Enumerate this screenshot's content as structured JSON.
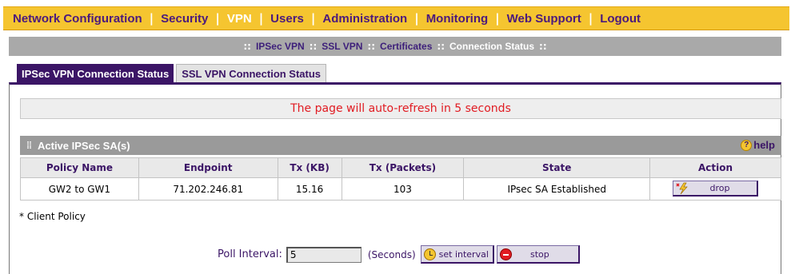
{
  "top_nav": {
    "items": [
      {
        "label": "Network Configuration",
        "active": false
      },
      {
        "label": "Security",
        "active": false
      },
      {
        "label": "VPN",
        "active": true
      },
      {
        "label": "Users",
        "active": false
      },
      {
        "label": "Administration",
        "active": false
      },
      {
        "label": "Monitoring",
        "active": false
      },
      {
        "label": "Web Support",
        "active": false
      },
      {
        "label": "Logout",
        "active": false
      }
    ],
    "separator": "|"
  },
  "sub_nav": {
    "items": [
      {
        "label": "IPSec VPN",
        "active": false
      },
      {
        "label": "SSL VPN",
        "active": false
      },
      {
        "label": "Certificates",
        "active": false
      },
      {
        "label": "Connection Status",
        "active": true
      }
    ],
    "separator": "::"
  },
  "tabs": [
    {
      "label": "IPSec VPN Connection Status",
      "active": true
    },
    {
      "label": "SSL VPN Connection Status",
      "active": false
    }
  ],
  "refresh_message": "The page will auto-refresh in 5 seconds",
  "section": {
    "title": "Active IPSec SA(s)",
    "grip_icon": "grip-icon",
    "help_label": "help",
    "help_icon": "question-circle-icon"
  },
  "table": {
    "columns": [
      "Policy Name",
      "Endpoint",
      "Tx (KB)",
      "Tx (Packets)",
      "State",
      "Action"
    ],
    "rows": [
      {
        "policy_name": "GW2 to GW1",
        "endpoint": "71.202.246.81",
        "tx_kb": "15.16",
        "tx_packets": "103",
        "state": "IPsec SA Established",
        "action_label": "drop",
        "action_icon": "lightning-drop-icon"
      }
    ]
  },
  "client_policy_note": "* Client Policy",
  "poll": {
    "label": "Poll Interval:",
    "value": "5",
    "unit": "(Seconds)",
    "set_interval_label": "set interval",
    "set_interval_icon": "clock-icon",
    "stop_label": "stop",
    "stop_icon": "stop-icon"
  },
  "colors": {
    "nav_bg": "#f5c530",
    "nav_text": "#4b1a7d",
    "accent_purple": "#3b1566",
    "refresh_text": "#e11b22",
    "section_header_bg": "#9a9a9a"
  }
}
